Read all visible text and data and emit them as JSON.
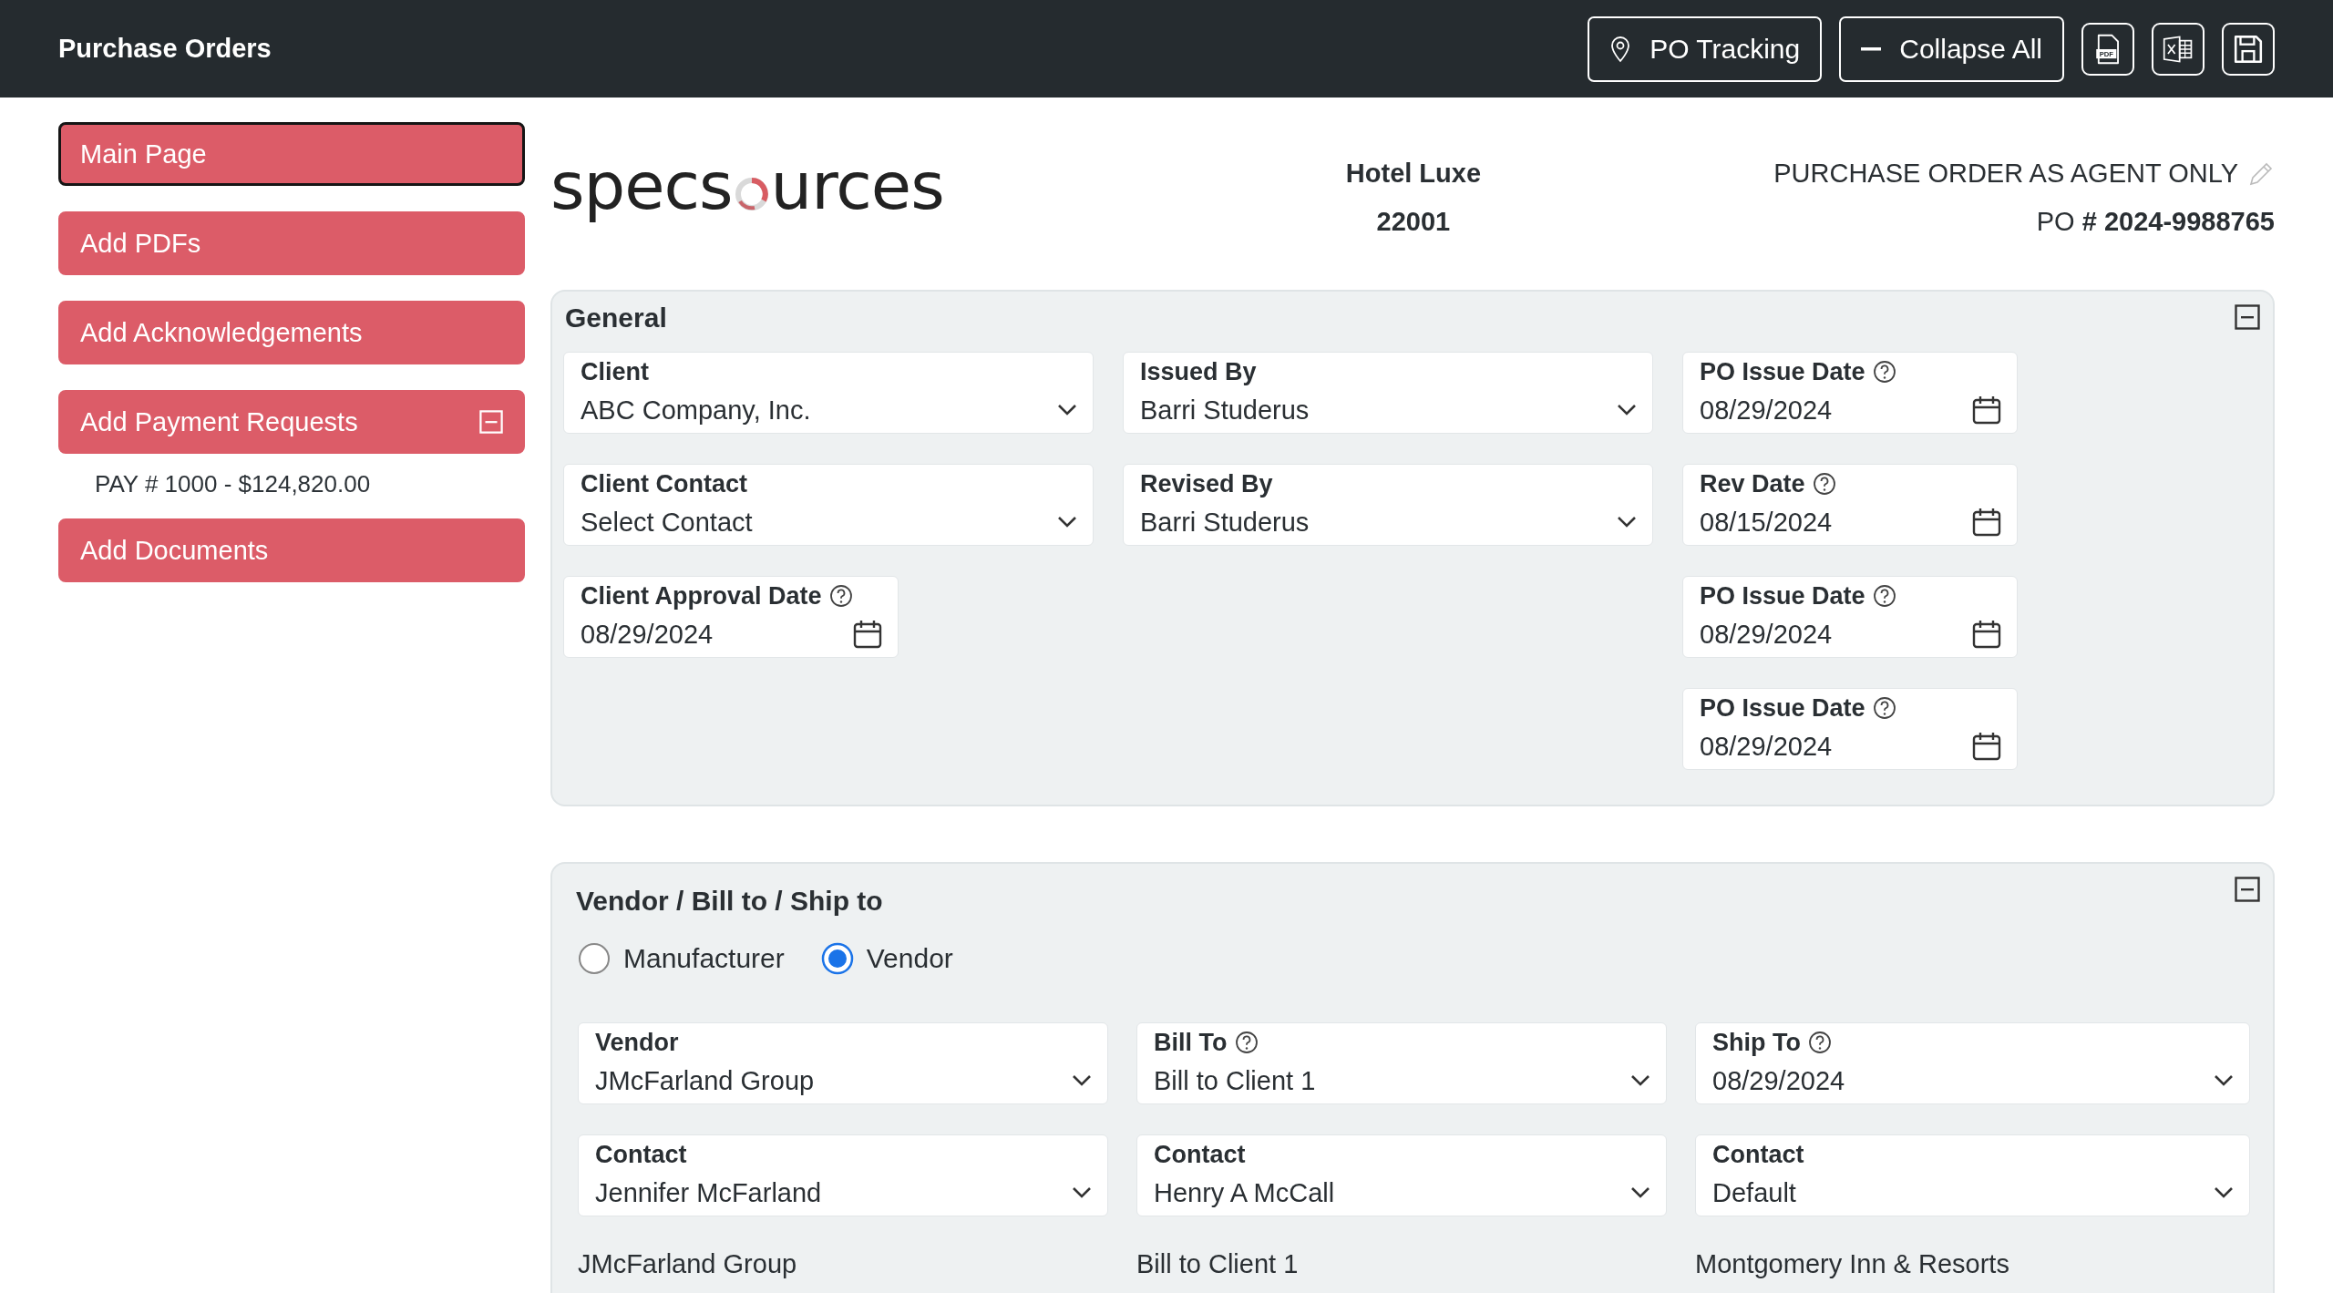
{
  "header": {
    "title": "Purchase Orders",
    "buttons": [
      {
        "kind": "text",
        "label": "PO Tracking"
      },
      {
        "kind": "text",
        "label": "Collapse All"
      },
      {
        "kind": "icon",
        "icon_text": "PDF"
      },
      {
        "kind": "icon"
      },
      {
        "kind": "icon"
      }
    ]
  },
  "sidebar": {
    "items": [
      {
        "kind": "button",
        "label": "Main Page",
        "selected": true
      },
      {
        "kind": "button",
        "label": "Add PDFs",
        "selected": false
      },
      {
        "kind": "button",
        "label": "Add Acknowledgements",
        "selected": false
      },
      {
        "kind": "group",
        "label": "Add Payment Requests",
        "selected": false,
        "expanded": true,
        "children": [
          {
            "label": "PAY # 1000 - $124,820.00"
          }
        ]
      },
      {
        "kind": "button",
        "label": "Add Documents",
        "selected": false
      }
    ]
  },
  "document": {
    "logo": {
      "before": "specs",
      "after": "urces"
    },
    "project": {
      "name": "Hotel Luxe",
      "number": "22001"
    },
    "agent_note": "PURCHASE ORDER AS AGENT ONLY",
    "po_number": "PO **# 2024-9988765**"
  },
  "general": {
    "title": "General",
    "expanded": true,
    "rows": [
      [
        {
          "kind": "select",
          "label": "Client",
          "value": "ABC Company, Inc.",
          "help": false
        },
        {
          "kind": "select",
          "label": "Issued By",
          "value": "Barri Studerus",
          "help": false
        },
        {
          "kind": "date",
          "label": "PO Issue Date",
          "value": "08/29/2024",
          "help": true
        }
      ],
      [
        {
          "kind": "select",
          "label": "Client Contact",
          "value": "Select Contact",
          "help": false
        },
        {
          "kind": "select",
          "label": "Revised By",
          "value": "Barri Studerus",
          "help": false
        },
        {
          "kind": "date",
          "label": "Rev Date",
          "value": "08/15/2024",
          "help": true
        }
      ],
      [
        {
          "kind": "date",
          "label": "Client Approval Date",
          "value": "08/29/2024",
          "help": true
        },
        null,
        {
          "kind": "date",
          "label": "PO Issue Date",
          "value": "08/29/2024",
          "help": true
        }
      ],
      [
        null,
        null,
        {
          "kind": "date",
          "label": "PO Issue Date",
          "value": "08/29/2024",
          "help": true
        }
      ]
    ]
  },
  "vendor": {
    "title": "Vendor / Bill to / Ship to",
    "expanded": true,
    "options": [
      {
        "label": "Manufacturer",
        "selected": false
      },
      {
        "label": "Vendor",
        "selected": true
      }
    ],
    "rows": [
      [
        {
          "kind": "select",
          "label": "Vendor",
          "value": "JMcFarland Group",
          "help": false
        },
        {
          "kind": "select",
          "label": "Bill To",
          "value": "Bill to Client 1",
          "help": true
        },
        {
          "kind": "select",
          "label": "Ship To",
          "value": "08/29/2024",
          "help": true
        }
      ],
      [
        {
          "kind": "select",
          "label": "Contact",
          "value": "Jennifer McFarland",
          "help": false
        },
        {
          "kind": "select",
          "label": "Contact",
          "value": "Henry A McCall",
          "help": false
        },
        {
          "kind": "select",
          "label": "Contact",
          "value": "Default",
          "help": false
        }
      ]
    ],
    "addresses": [
      "JMcFarland Group",
      "Bill to Client 1",
      "Montgomery Inn & Resorts"
    ]
  }
}
